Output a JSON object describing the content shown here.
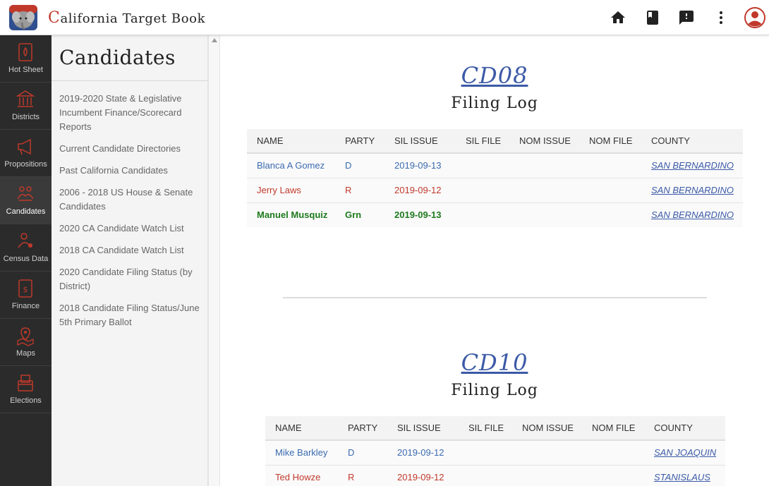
{
  "header": {
    "brand_cap": "C",
    "brand_rest": "alifornia",
    "brand_suffix": "Target Book",
    "icons": [
      "home-icon",
      "book-icon",
      "feedback-icon",
      "more-vert-icon",
      "account-icon"
    ],
    "accent_color": "#c0392b"
  },
  "rail": {
    "items": [
      {
        "label": "Hot Sheet",
        "icon": "hot-sheet-icon"
      },
      {
        "label": "Districts",
        "icon": "districts-icon"
      },
      {
        "label": "Propositions",
        "icon": "propositions-icon"
      },
      {
        "label": "Candidates",
        "icon": "candidates-icon",
        "active": true
      },
      {
        "label": "Census Data",
        "icon": "census-data-icon"
      },
      {
        "label": "Finance",
        "icon": "finance-icon"
      },
      {
        "label": "Maps",
        "icon": "maps-icon"
      },
      {
        "label": "Elections",
        "icon": "elections-icon"
      }
    ]
  },
  "sidemenu": {
    "title": "Candidates",
    "links": [
      "2019-2020 State & Legislative Incumbent Finance/Scorecard Reports",
      "Current Candidate Directories",
      "Past California Candidates",
      "2006 - 2018 US House & Senate Candidates",
      "2020 CA Candidate Watch List",
      "2018 CA Candidate Watch List",
      "2020 Candidate Filing Status (by District)",
      "2018 Candidate Filing Status/June 5th Primary Ballot"
    ]
  },
  "columns": [
    "NAME",
    "PARTY",
    "SIL ISSUE",
    "SIL FILE",
    "NOM ISSUE",
    "NOM FILE",
    "COUNTY"
  ],
  "sections": [
    {
      "district": "CD08",
      "subtitle": "Filing Log",
      "rows": [
        {
          "name": "Blanca A Gomez",
          "party": "D",
          "sil_issue": "2019-09-13",
          "sil_file": "",
          "nom_issue": "",
          "nom_file": "",
          "county": "SAN BERNARDINO"
        },
        {
          "name": "Jerry Laws",
          "party": "R",
          "sil_issue": "2019-09-12",
          "sil_file": "",
          "nom_issue": "",
          "nom_file": "",
          "county": "SAN BERNARDINO"
        },
        {
          "name": "Manuel Musquiz",
          "party": "Grn",
          "sil_issue": "2019-09-13",
          "sil_file": "",
          "nom_issue": "",
          "nom_file": "",
          "county": "SAN BERNARDINO"
        }
      ]
    },
    {
      "district": "CD10",
      "subtitle": "Filing Log",
      "rows": [
        {
          "name": "Mike Barkley",
          "party": "D",
          "sil_issue": "2019-09-12",
          "sil_file": "",
          "nom_issue": "",
          "nom_file": "",
          "county": "SAN JOAQUIN"
        },
        {
          "name": "Ted Howze",
          "party": "R",
          "sil_issue": "2019-09-12",
          "sil_file": "",
          "nom_issue": "",
          "nom_file": "",
          "county": "STANISLAUS"
        }
      ]
    }
  ],
  "party_colors": {
    "D": "#3b6bb0",
    "R": "#c0392b",
    "Grn": "#1e7a1e"
  }
}
